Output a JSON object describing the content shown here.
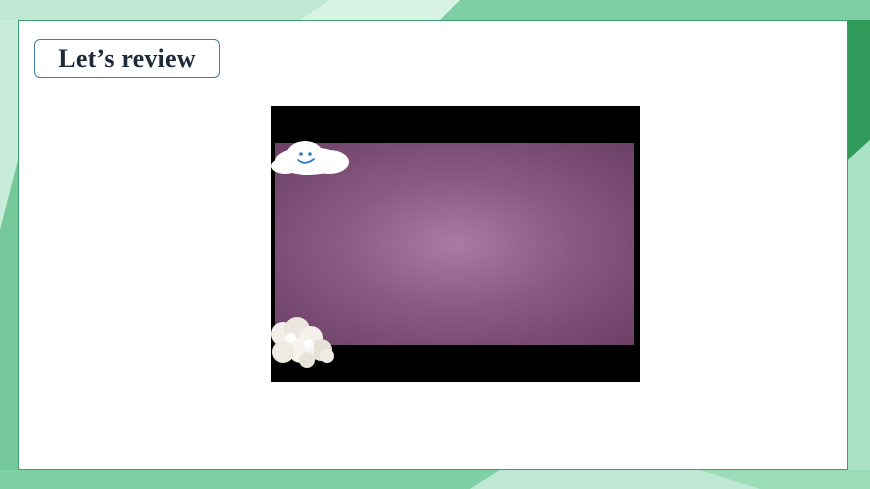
{
  "slide": {
    "title": "Let’s review"
  },
  "video": {
    "icon": "smiley-cloud-icon",
    "decoration": "cotton-cloud-icon"
  },
  "colors": {
    "accent_green": "#3f9f74",
    "title_border": "#3f7fa8",
    "video_purple": "#8a5a84"
  }
}
